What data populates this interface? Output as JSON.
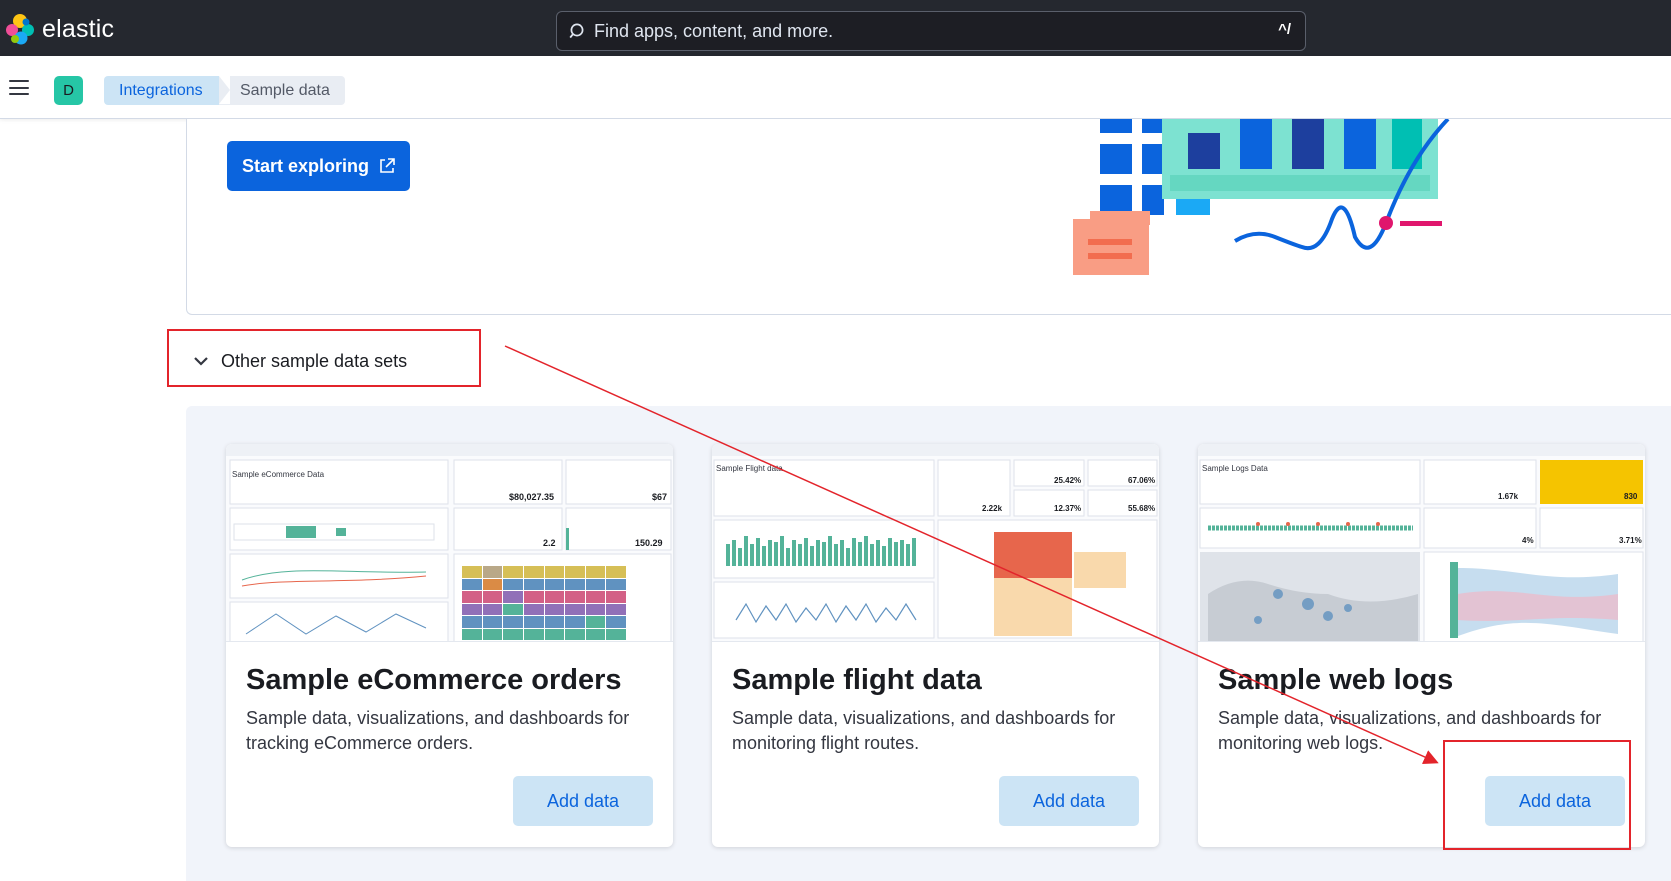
{
  "header": {
    "brand": "elastic",
    "search_placeholder": "Find apps, content, and more.",
    "search_shortcut": "^/"
  },
  "subheader": {
    "avatar_initial": "D",
    "breadcrumbs": [
      "Integrations",
      "Sample data"
    ]
  },
  "hero": {
    "button_label": "Start exploring"
  },
  "accordion": {
    "label": "Other sample data sets"
  },
  "cards": [
    {
      "title": "Sample eCommerce orders",
      "description": "Sample data, visualizations, and dashboards for tracking eCommerce orders.",
      "button": "Add data",
      "thumb": {
        "heading": "Sample eCommerce Data",
        "metric1": "$80,027.35",
        "metric2": "$67",
        "metric3": "2.2",
        "metric4": "150.29"
      }
    },
    {
      "title": "Sample flight data",
      "description": "Sample data, visualizations, and dashboards for monitoring flight routes.",
      "button": "Add data",
      "thumb": {
        "heading": "Sample Flight data",
        "metric1": "2.22k",
        "metric2": "25.42%",
        "metric3": "67.06%",
        "metric4": "12.37%",
        "metric5": "55.68%"
      }
    },
    {
      "title": "Sample web logs",
      "description": "Sample data, visualizations, and dashboards for monitoring web logs.",
      "button": "Add data",
      "thumb": {
        "heading": "Sample Logs Data",
        "metric1": "1.67k",
        "metric2": "830",
        "metric3": "4%",
        "metric4": "3.71%"
      }
    }
  ],
  "colors": {
    "accent": "#0b64dd",
    "header_bg": "#25282f",
    "annotation": "#e3242b"
  }
}
